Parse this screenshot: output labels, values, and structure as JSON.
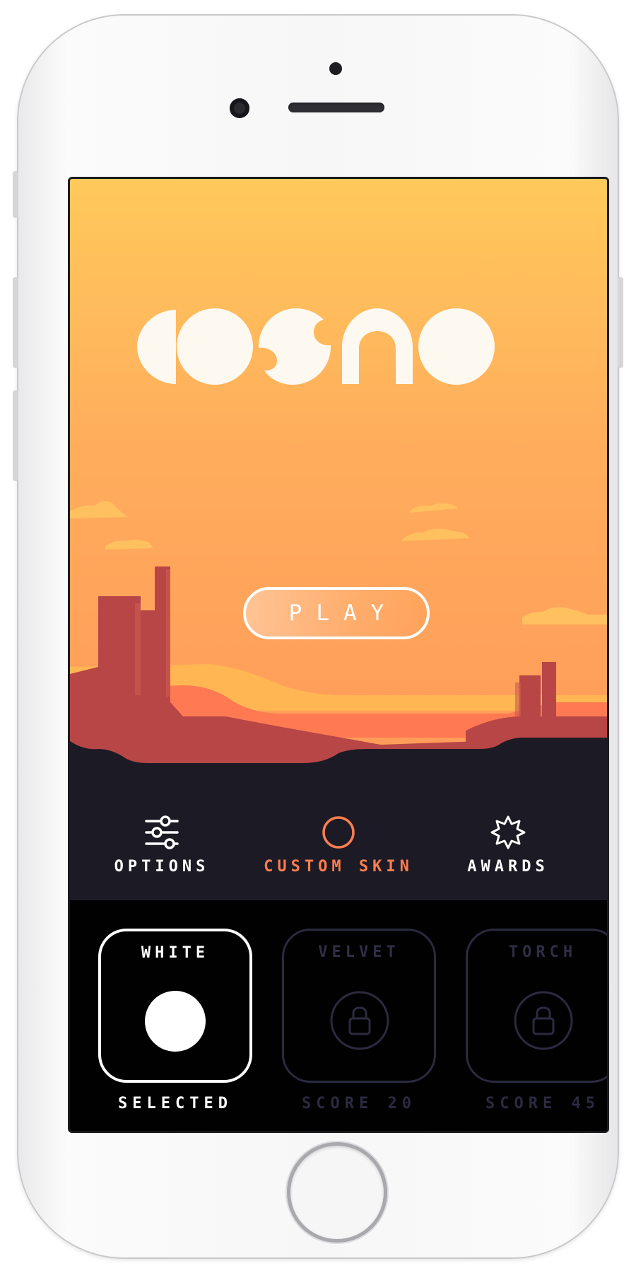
{
  "colors": {
    "sky_top": "#ffc95b",
    "sky_bottom": "#ff9a5a",
    "accent": "#ff7d4f",
    "menu_bg": "#1c1b25",
    "skins_bg": "#010102",
    "locked": "#2b2a40"
  },
  "game": {
    "logo_text": "COSMO",
    "play_label": "PLAY"
  },
  "menu": {
    "options": {
      "label": "OPTIONS",
      "icon": "sliders-icon"
    },
    "custom_skin": {
      "label": "CUSTOM SKIN",
      "icon": "ring-icon",
      "active": true
    },
    "awards": {
      "label": "AWARDS",
      "icon": "starburst-icon"
    }
  },
  "skins": [
    {
      "name": "WHITE",
      "status": "SELECTED",
      "state": "selected"
    },
    {
      "name": "VELVET",
      "status": "SCORE 20",
      "state": "locked",
      "icon": "lock-icon"
    },
    {
      "name": "TORCH",
      "status": "SCORE 45",
      "state": "locked",
      "icon": "lock-icon"
    }
  ]
}
